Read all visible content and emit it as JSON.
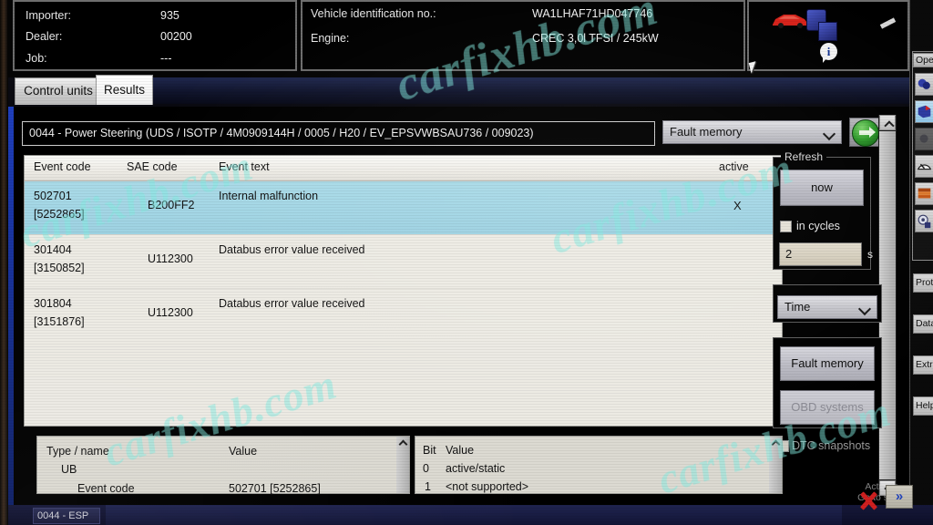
{
  "header": {
    "importer_label": "Importer:",
    "importer_value": "935",
    "dealer_label": "Dealer:",
    "dealer_value": "00200",
    "job_label": "Job:",
    "job_value": "---",
    "vin_label": "Vehicle identification no.:",
    "vin_value": "WA1LHAF71HD047746",
    "engine_label": "Engine:",
    "engine_value": "CREC 3,0l TFSI / 245kW"
  },
  "tabs": [
    {
      "label": "Control units",
      "selected": false
    },
    {
      "label": "Results",
      "selected": true
    }
  ],
  "path": "0044 - Power Steering  (UDS / ISOTP / 4M0909144H / 0005 / H20 / EV_EPSVWBSAU736 / 009023)",
  "memory_select": {
    "value": "Fault memory"
  },
  "go_button": "go-arrow",
  "table": {
    "columns": [
      "Event code",
      "SAE code",
      "Event text",
      "active"
    ],
    "rows": [
      {
        "event_code": "502701",
        "event_code_ref": "[5252865]",
        "sae_code": "B200FF2",
        "event_text": "Internal malfunction",
        "active": "X",
        "selected": true
      },
      {
        "event_code": "301404",
        "event_code_ref": "[3150852]",
        "sae_code": "U112300",
        "event_text": "Databus error value received",
        "active": "",
        "selected": false
      },
      {
        "event_code": "301804",
        "event_code_ref": "[3151876]",
        "sae_code": "U112300",
        "event_text": "Databus error value received",
        "active": "",
        "selected": false
      }
    ]
  },
  "refresh_panel": {
    "title": "Refresh",
    "now_button": "now",
    "in_cycles_label": "in cycles",
    "cycle_value": "2",
    "cycle_unit": "s"
  },
  "time_select": {
    "value": "Time"
  },
  "memory_buttons": {
    "fault_memory": "Fault memory",
    "obd_systems": "OBD systems"
  },
  "dtc_snapshots_label": "DTC snapshots",
  "detail_panel": {
    "columns": [
      "Type / name",
      "Value"
    ],
    "rows": [
      {
        "name": "UB",
        "value": ""
      },
      {
        "name": "Event code",
        "value": "502701 [5252865]"
      }
    ]
  },
  "bit_panel": {
    "columns": [
      "Bit",
      "Value"
    ],
    "rows": [
      {
        "bit": "0",
        "value": "active/static"
      },
      {
        "bit": "1",
        "value": "<not supported>"
      }
    ]
  },
  "sidebar": {
    "group_title": "Ope",
    "icons": [
      {
        "name": "diagnosis-icon",
        "state": "normal"
      },
      {
        "name": "fault-memory-icon",
        "state": "active"
      },
      {
        "name": "disabled-icon",
        "state": "disabled"
      },
      {
        "name": "gauge-icon",
        "state": "normal"
      },
      {
        "name": "books-icon",
        "state": "normal"
      },
      {
        "name": "settings-gear-icon",
        "state": "normal"
      }
    ],
    "buttons": [
      "Proto",
      "Data",
      "Extra",
      "Help"
    ]
  },
  "taskbar": {
    "item": "0044 - ESP"
  },
  "activation": {
    "line1": "Activate",
    "line2": "Go to settin"
  },
  "watermarks": [
    "carfixhb.com",
    "carfixhb.com",
    "carfixhb.com",
    "carfixhb.com",
    "carfixhb.com"
  ]
}
